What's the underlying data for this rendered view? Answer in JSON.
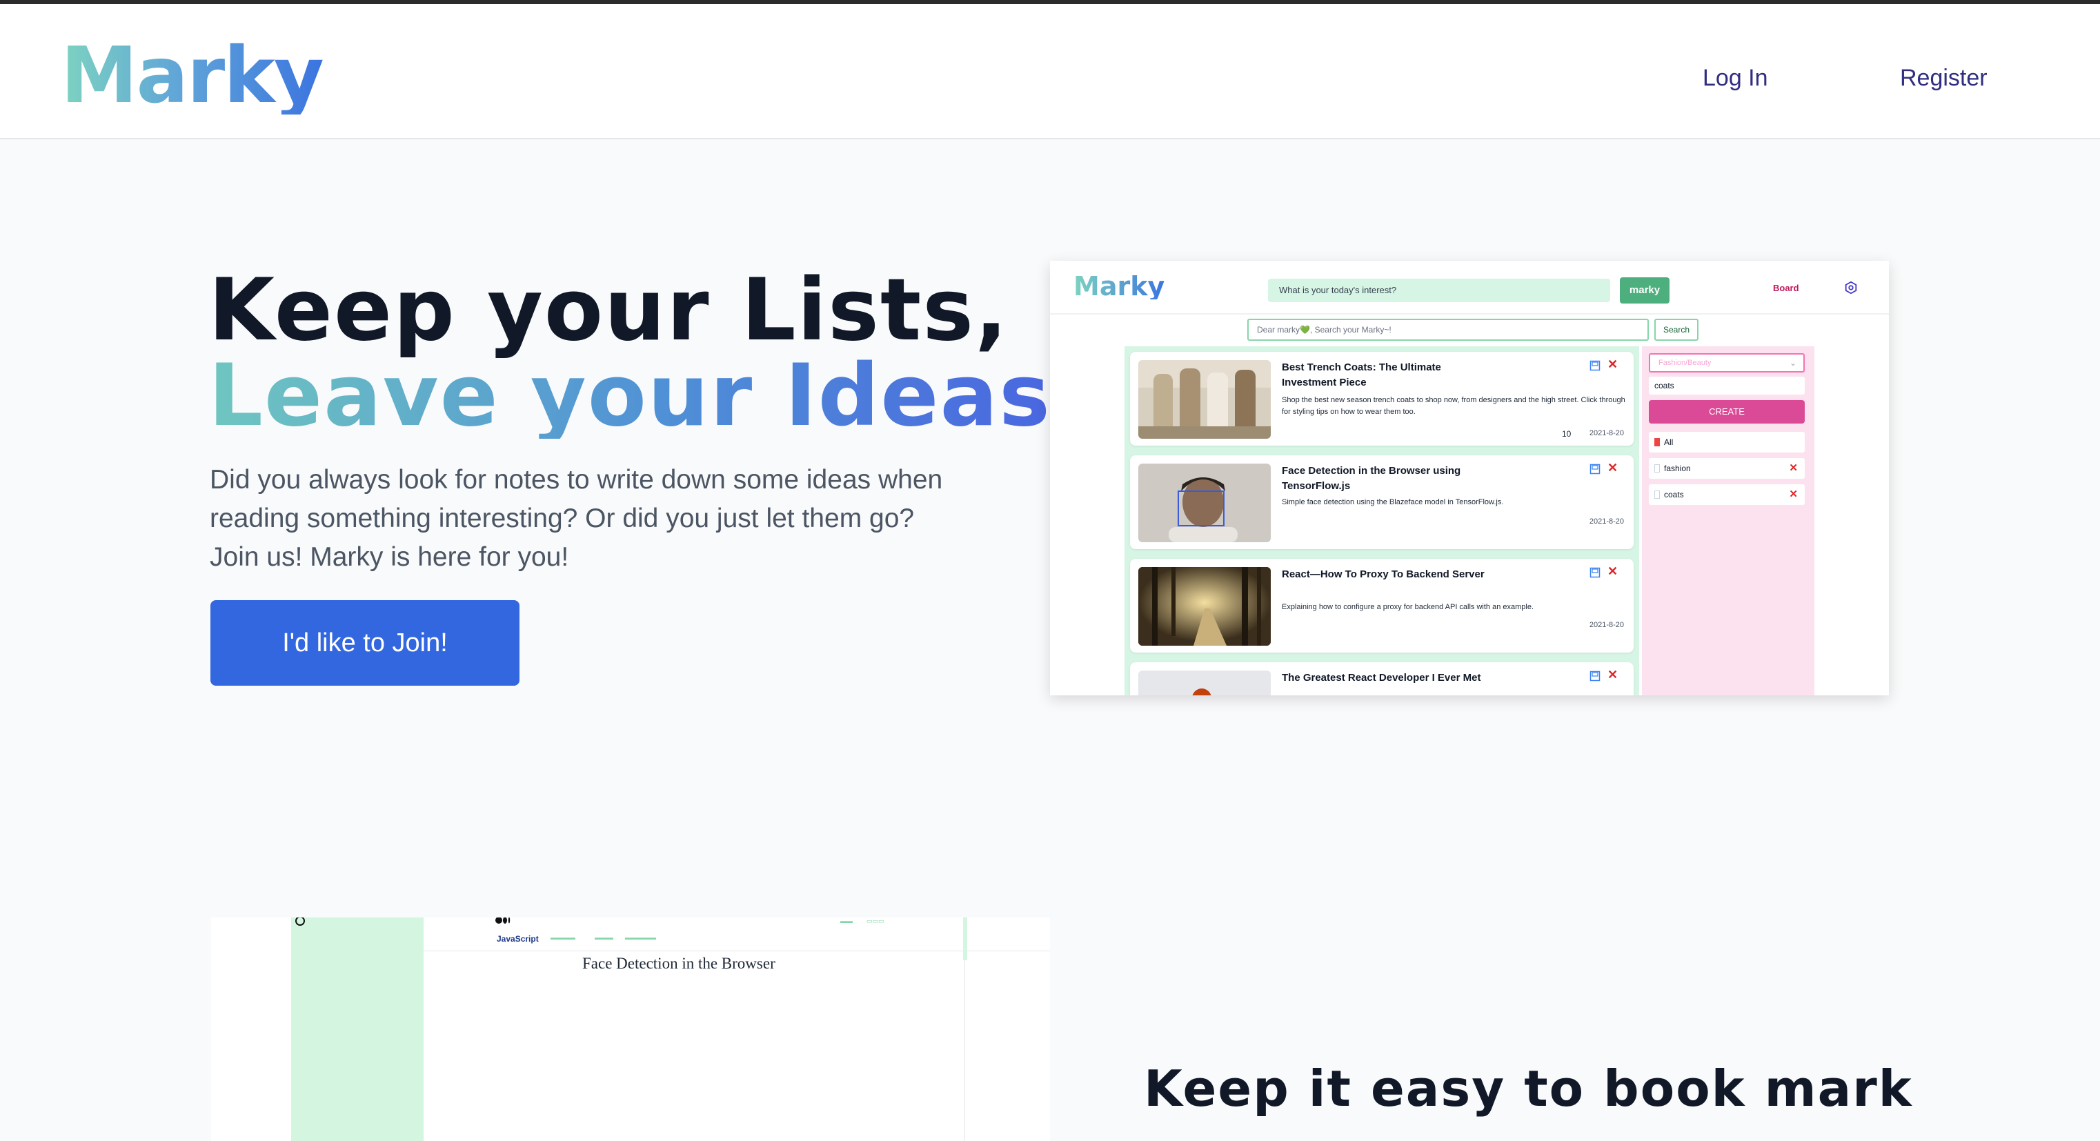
{
  "header": {
    "logo": "Marky",
    "login_label": "Log In",
    "register_label": "Register"
  },
  "hero": {
    "title_line1": "Keep your Lists,",
    "title_line2": "Leave your Ideas",
    "description": "Did you always look for notes to write down some ideas when reading something interesting? Or did you just let them go? Join us! Marky is here for you!",
    "join_label": "I'd like to Join!"
  },
  "preview": {
    "logo": "Marky",
    "interest_placeholder": "What is your today's interest?",
    "marky_button": "marky",
    "board_link": "Board",
    "search_placeholder": "Dear marky💚, Search your Marky~!",
    "search_button": "Search",
    "cards": [
      {
        "title": "Best Trench Coats: The Ultimate Investment Piece",
        "description": "Shop the best new season trench coats to shop now, from designers and the high street. Click through for styling tips on how to wear them too.",
        "count": "10",
        "date": "2021-8-20"
      },
      {
        "title": "Face Detection in the Browser using TensorFlow.js",
        "description": "Simple face detection using the Blazeface model in TensorFlow.js.",
        "count": "",
        "date": "2021-8-20"
      },
      {
        "title": "React—How To Proxy To Backend Server",
        "description": "Explaining how to configure a proxy for backend API calls with an example.",
        "count": "",
        "date": "2021-8-20"
      },
      {
        "title": "The Greatest React Developer I Ever Met",
        "description": "",
        "count": "",
        "date": ""
      }
    ],
    "sidebar": {
      "category_placeholder": "Fashion/Beauty",
      "tag_input_value": "coats",
      "create_button": "CREATE",
      "tags": [
        "All",
        "fashion",
        "coats"
      ]
    }
  },
  "section2": {
    "preview_tag": "JavaScript",
    "preview_article_title": "Face Detection in the Browser",
    "title": "Keep it easy to book mark"
  },
  "colors": {
    "primary_button": "#3367e0",
    "nav_link": "#312e81",
    "preview_green": "#d6f5e4",
    "preview_pink": "#fbe2ee",
    "create_pink": "#db4a97"
  }
}
